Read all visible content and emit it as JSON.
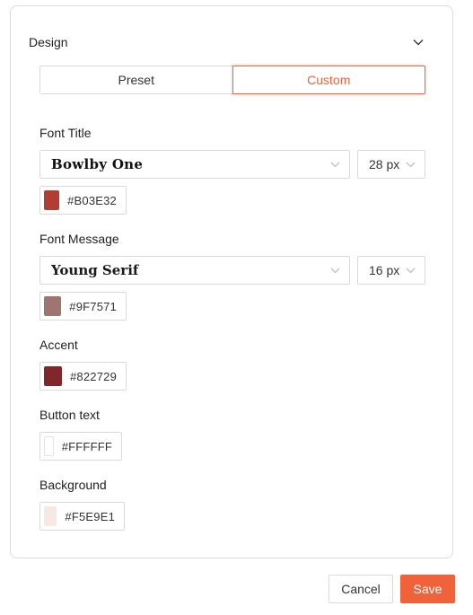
{
  "design": {
    "title": "Design",
    "tabs": {
      "preset": "Preset",
      "custom": "Custom"
    },
    "active_tab": "Custom",
    "font_title": {
      "label": "Font Title",
      "font": "Bowlby One",
      "size": "28 px",
      "color_hex": "#B03E32",
      "color": "#B03E32"
    },
    "font_message": {
      "label": "Font Message",
      "font": "Young Serif",
      "size": "16 px",
      "color_hex": "#9F7571",
      "color": "#9F7571"
    },
    "accent": {
      "label": "Accent",
      "color_hex": "#822729",
      "color": "#822729"
    },
    "button_text": {
      "label": "Button text",
      "color_hex": "#FFFFFF",
      "color": "#FFFFFF"
    },
    "background": {
      "label": "Background",
      "color_hex": "#F5E9E1",
      "color": "#F5E9E1"
    }
  },
  "footer": {
    "cancel_label": "Cancel",
    "save_label": "Save"
  },
  "theme": {
    "accent_orange": "#F0623A",
    "border": "#D9D9D9"
  },
  "icons": {
    "collapse": "chevron-down-icon",
    "dropdown": "chevron-down-icon"
  }
}
